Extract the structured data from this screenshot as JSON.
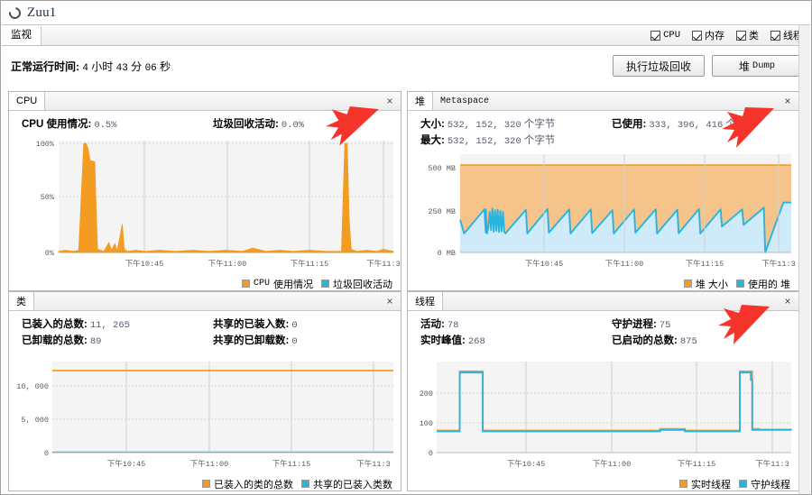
{
  "window": {
    "title": "Zuu1",
    "icon": "ring-icon"
  },
  "tabs": {
    "active": "监视"
  },
  "checkboxes": [
    {
      "label": "CPU",
      "checked": true,
      "mono": true
    },
    {
      "label": "内存",
      "checked": true,
      "mono": false
    },
    {
      "label": "类",
      "checked": true,
      "mono": false
    },
    {
      "label": "线程",
      "checked": true,
      "mono": false
    }
  ],
  "uptime": {
    "label": "正常运行时间:",
    "hours": "4",
    "hours_unit": "小时",
    "minutes": "43",
    "minutes_unit": "分",
    "seconds": "06",
    "seconds_unit": "秒"
  },
  "toolbar": {
    "gc_button": "执行垃圾回收",
    "heapdump_button_cn": "堆",
    "heapdump_button_en": "Dump"
  },
  "panels": {
    "cpu": {
      "tab": "CPU",
      "close": "×",
      "stats": [
        {
          "label": "CPU 使用情况:",
          "value": "0.5%"
        },
        {
          "label": "垃圾回收活动:",
          "value": "0.0%"
        }
      ],
      "legend": [
        {
          "label": "CPU 使用情况",
          "color": "#f49b22",
          "mono_prefix": "CPU"
        },
        {
          "label": "垃圾回收活动",
          "color": "#29b4e0"
        }
      ]
    },
    "heap": {
      "tab_active": "堆",
      "tab_inactive": "Metaspace",
      "close": "×",
      "stats": [
        {
          "label": "大小:",
          "value": "532, 152, 320",
          "unit": "个字节"
        },
        {
          "label": "已使用:",
          "value": "333, 396, 416",
          "unit": "个字节"
        },
        {
          "label": "最大:",
          "value": "532, 152, 320",
          "unit": "个字节"
        }
      ],
      "legend": [
        {
          "label": "堆 大小",
          "color": "#f49b22"
        },
        {
          "label": "使用的 堆",
          "color": "#29b4e0"
        }
      ]
    },
    "classes": {
      "tab": "类",
      "close": "×",
      "stats": [
        {
          "label": "已装入的总数:",
          "value": "11, 265"
        },
        {
          "label": "共享的已装入数:",
          "value": "0"
        },
        {
          "label": "已卸载的总数:",
          "value": "89"
        },
        {
          "label": "共享的已卸载数:",
          "value": "0"
        }
      ],
      "legend": [
        {
          "label": "已装入的类的总数",
          "color": "#f49b22"
        },
        {
          "label": "共享的已装入类数",
          "color": "#29b4e0"
        }
      ]
    },
    "threads": {
      "tab": "线程",
      "close": "×",
      "stats": [
        {
          "label": "活动:",
          "value": "78"
        },
        {
          "label": "守护进程:",
          "value": "75"
        },
        {
          "label": "实时峰值:",
          "value": "268"
        },
        {
          "label": "已启动的总数:",
          "value": "875"
        }
      ],
      "legend": [
        {
          "label": "实时线程",
          "color": "#f49b22"
        },
        {
          "label": "守护线程",
          "color": "#29b4e0"
        }
      ]
    }
  },
  "chart_data": [
    {
      "id": "cpu",
      "type": "area",
      "title": "CPU",
      "xlabel": "",
      "ylabel": "",
      "ylim": [
        0,
        100
      ],
      "yticks": [
        "0%",
        "50%",
        "100%"
      ],
      "ytick_values": [
        0,
        50,
        100
      ],
      "xticks": [
        "下午10:45",
        "下午11:00",
        "下午11:15",
        "下午11:3"
      ],
      "xtick_positions": [
        0.255,
        0.5,
        0.745,
        0.965
      ],
      "grid": true,
      "series": [
        {
          "name": "CPU 使用情况",
          "color": "#f49b22",
          "points": [
            [
              0.0,
              1
            ],
            [
              0.02,
              2
            ],
            [
              0.045,
              1
            ],
            [
              0.06,
              2
            ],
            [
              0.075,
              100
            ],
            [
              0.082,
              100
            ],
            [
              0.088,
              95
            ],
            [
              0.094,
              84
            ],
            [
              0.1,
              84
            ],
            [
              0.108,
              83
            ],
            [
              0.112,
              40
            ],
            [
              0.116,
              3
            ],
            [
              0.125,
              2
            ],
            [
              0.135,
              1
            ],
            [
              0.15,
              9
            ],
            [
              0.158,
              2
            ],
            [
              0.168,
              8
            ],
            [
              0.175,
              1
            ],
            [
              0.19,
              26
            ],
            [
              0.196,
              3
            ],
            [
              0.205,
              1
            ],
            [
              0.23,
              2
            ],
            [
              0.26,
              1
            ],
            [
              0.3,
              2
            ],
            [
              0.35,
              1
            ],
            [
              0.4,
              2
            ],
            [
              0.45,
              1
            ],
            [
              0.5,
              2
            ],
            [
              0.55,
              1
            ],
            [
              0.58,
              4
            ],
            [
              0.62,
              1
            ],
            [
              0.66,
              2
            ],
            [
              0.7,
              1
            ],
            [
              0.75,
              2
            ],
            [
              0.8,
              1
            ],
            [
              0.845,
              1
            ],
            [
              0.855,
              100
            ],
            [
              0.862,
              100
            ],
            [
              0.868,
              30
            ],
            [
              0.874,
              3
            ],
            [
              0.89,
              1
            ],
            [
              0.92,
              2
            ],
            [
              0.95,
              1
            ],
            [
              0.97,
              3
            ],
            [
              1.0,
              1
            ]
          ]
        },
        {
          "name": "垃圾回收活动",
          "color": "#29b4e0",
          "points": [
            [
              0.0,
              0
            ],
            [
              0.07,
              0
            ],
            [
              0.085,
              3
            ],
            [
              0.095,
              3
            ],
            [
              0.11,
              2
            ],
            [
              0.12,
              0
            ],
            [
              0.4,
              0
            ],
            [
              0.6,
              0
            ],
            [
              0.85,
              0
            ],
            [
              0.857,
              5
            ],
            [
              0.866,
              4
            ],
            [
              0.875,
              0
            ],
            [
              1.0,
              0
            ]
          ]
        }
      ]
    },
    {
      "id": "heap",
      "type": "area",
      "title": "堆",
      "ylim": [
        0,
        570
      ],
      "yticks": [
        "0 MB",
        "250 MB",
        "500 MB"
      ],
      "ytick_values": [
        0,
        250,
        500
      ],
      "xticks": [
        "下午10:45",
        "下午11:00",
        "下午11:15",
        "下午11:3"
      ],
      "xtick_positions": [
        0.255,
        0.5,
        0.745,
        0.965
      ],
      "grid": true,
      "series": [
        {
          "name": "堆 大小",
          "color": "#f49b22",
          "flat_value": 507
        },
        {
          "name": "使用的 堆",
          "color": "#29b4e0",
          "sawtooth_peaks": [
            250,
            255,
            248,
            252,
            250,
            250,
            245,
            250,
            250,
            248,
            252,
            250,
            250,
            260,
            290
          ],
          "sawtooth_troughs": [
            110,
            115,
            112,
            110,
            115,
            110,
            112,
            110,
            115,
            110,
            112,
            110,
            150,
            160,
            0
          ]
        }
      ]
    },
    {
      "id": "classes",
      "type": "line",
      "title": "类",
      "ylim": [
        0,
        12500
      ],
      "yticks": [
        "0",
        "5, 000",
        "10, 000"
      ],
      "ytick_values": [
        0,
        5000,
        10000
      ],
      "xticks": [
        "下午10:45",
        "下午11:00",
        "下午11:15",
        "下午11:3"
      ],
      "xtick_positions": [
        0.255,
        0.5,
        0.745,
        0.965
      ],
      "grid": true,
      "series": [
        {
          "name": "已装入的类的总数",
          "color": "#f49b22",
          "flat_value": 11265
        },
        {
          "name": "共享的已装入类数",
          "color": "#29b4e0",
          "flat_value": 0
        }
      ]
    },
    {
      "id": "threads",
      "type": "line",
      "title": "线程",
      "ylim": [
        0,
        300
      ],
      "yticks": [
        "0",
        "100",
        "200"
      ],
      "ytick_values": [
        0,
        100,
        200
      ],
      "xticks": [
        "下午10:45",
        "下午11:00",
        "下午11:15",
        "下午11:3"
      ],
      "xtick_positions": [
        0.255,
        0.5,
        0.745,
        0.965
      ],
      "grid": true,
      "series": [
        {
          "name": "实时线程",
          "color": "#f49b22",
          "points": [
            [
              0.0,
              73
            ],
            [
              0.06,
              73
            ],
            [
              0.065,
              268
            ],
            [
              0.125,
              268
            ],
            [
              0.13,
              73
            ],
            [
              0.6,
              73
            ],
            [
              0.63,
              78
            ],
            [
              0.69,
              78
            ],
            [
              0.7,
              73
            ],
            [
              0.845,
              73
            ],
            [
              0.855,
              268
            ],
            [
              0.885,
              268
            ],
            [
              0.89,
              78
            ],
            [
              0.9,
              78
            ],
            [
              0.91,
              76
            ],
            [
              1.0,
              76
            ]
          ]
        },
        {
          "name": "守护线程",
          "color": "#29b4e0",
          "points": [
            [
              0.0,
              70
            ],
            [
              0.06,
              70
            ],
            [
              0.065,
              264
            ],
            [
              0.125,
              264
            ],
            [
              0.13,
              70
            ],
            [
              0.6,
              70
            ],
            [
              0.63,
              75
            ],
            [
              0.69,
              75
            ],
            [
              0.7,
              70
            ],
            [
              0.845,
              70
            ],
            [
              0.855,
              264
            ],
            [
              0.882,
              264
            ],
            [
              0.886,
              240
            ],
            [
              0.89,
              75
            ],
            [
              1.0,
              74
            ]
          ]
        }
      ]
    }
  ],
  "annotations": [
    {
      "name": "arrow-cpu",
      "color": "#f5342c"
    },
    {
      "name": "arrow-heap",
      "color": "#f5342c"
    },
    {
      "name": "arrow-threads",
      "color": "#f5342c"
    }
  ]
}
